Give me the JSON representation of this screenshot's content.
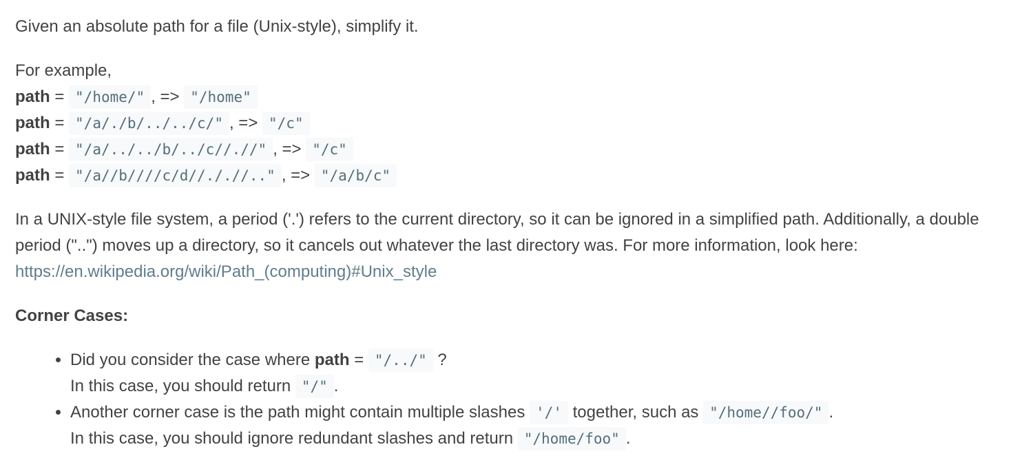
{
  "intro": "Given an absolute path for a file (Unix-style), simplify it.",
  "examples": {
    "heading": "For example,",
    "label": "path",
    "eq": "=",
    "arrow": ", =>",
    "items": [
      {
        "input": "\"/home/\"",
        "output": "\"/home\""
      },
      {
        "input": "\"/a/./b/../../c/\"",
        "output": "\"/c\""
      },
      {
        "input": "\"/a/../../b/../c//.//\"",
        "output": "\"/c\""
      },
      {
        "input": "\"/a//b////c/d//././/..\"",
        "output": "\"/a/b/c\""
      }
    ]
  },
  "description": {
    "text": "In a UNIX-style file system, a period ('.') refers to the current directory, so it can be ignored in a simplified path. Additionally, a double period (\"..\") moves up a directory, so it cancels out whatever the last directory was. For more information, look here: ",
    "link": "https://en.wikipedia.org/wiki/Path_(computing)#Unix_style"
  },
  "corner": {
    "title": "Corner Cases:",
    "item1": {
      "pre": "Did you consider the case where ",
      "bold": "path",
      "eq": " = ",
      "code": "\"/../\"",
      "post": " ?",
      "line2_pre": "In this case, you should return ",
      "line2_code": "\"/\"",
      "line2_post": "."
    },
    "item2": {
      "pre": "Another corner case is the path might contain multiple slashes ",
      "code1": "'/'",
      "mid": " together, such as ",
      "code2": "\"/home//foo/\"",
      "post": ".",
      "line2_pre": "In this case, you should ignore redundant slashes and return ",
      "line2_code": "\"/home/foo\"",
      "line2_post": "."
    }
  }
}
